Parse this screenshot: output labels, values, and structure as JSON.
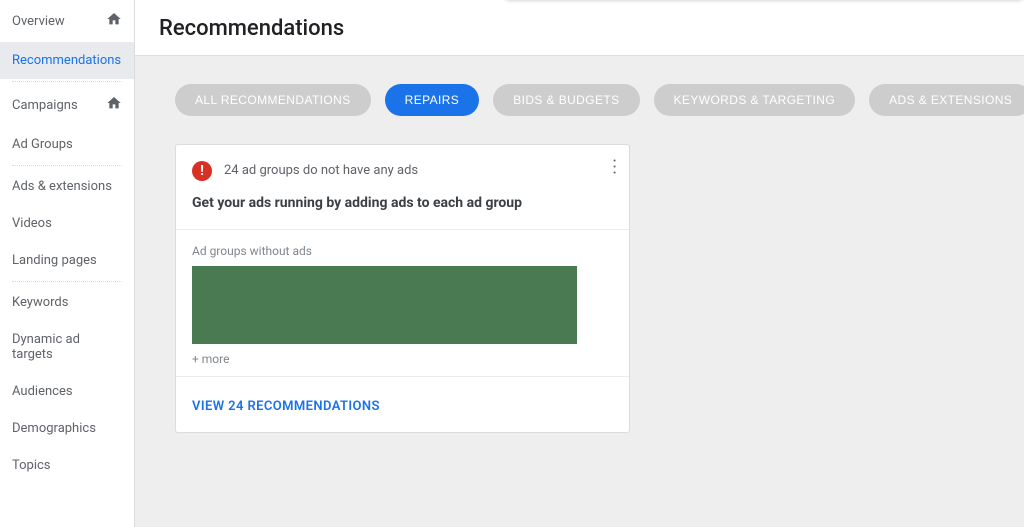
{
  "sidebar": {
    "items": [
      {
        "label": "Overview",
        "home": true
      },
      {
        "label": "Recommendations",
        "active": true
      },
      {
        "label": "Campaigns",
        "home": true
      },
      {
        "label": "Ad Groups"
      },
      {
        "label": "Ads & extensions"
      },
      {
        "label": "Videos"
      },
      {
        "label": "Landing pages"
      },
      {
        "label": "Keywords"
      },
      {
        "label": "Dynamic ad targets"
      },
      {
        "label": "Audiences"
      },
      {
        "label": "Demographics"
      },
      {
        "label": "Topics"
      }
    ]
  },
  "header": {
    "title": "Recommendations"
  },
  "pills": [
    {
      "label": "ALL RECOMMENDATIONS"
    },
    {
      "label": "REPAIRS",
      "active": true
    },
    {
      "label": "BIDS & BUDGETS"
    },
    {
      "label": "KEYWORDS & TARGETING"
    },
    {
      "label": "ADS & EXTENSIONS"
    }
  ],
  "card": {
    "alert_text": "24 ad groups do not have any ads",
    "title": "Get your ads running by adding ads to each ad group",
    "body_label": "Ad groups without ads",
    "more_text": "+ more",
    "footer_link": "VIEW 24 RECOMMENDATIONS"
  }
}
